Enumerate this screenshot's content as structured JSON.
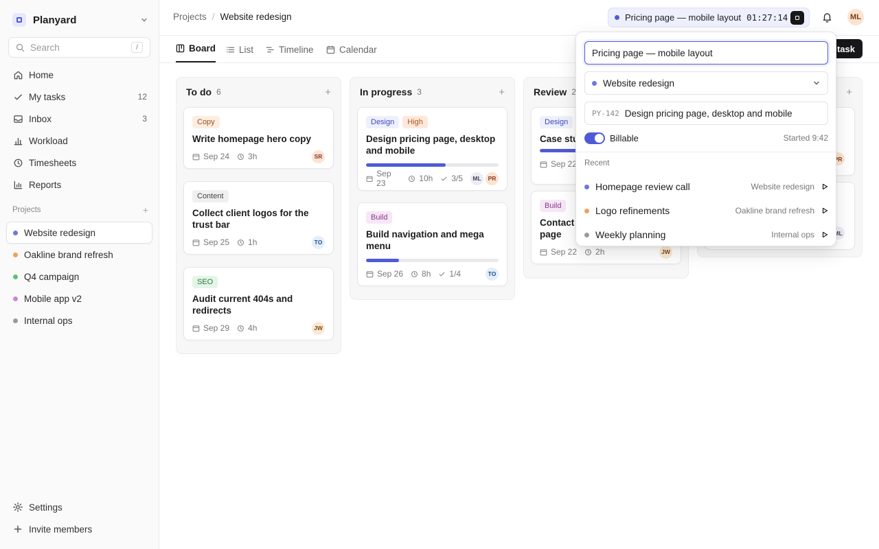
{
  "sidebar": {
    "workspace": "Planyard",
    "search_placeholder": "Search",
    "search_shortcut": "/",
    "nav": [
      {
        "label": "Home",
        "icon": "home-icon",
        "count": ""
      },
      {
        "label": "My tasks",
        "icon": "check-icon",
        "count": "12"
      },
      {
        "label": "Inbox",
        "icon": "inbox-icon",
        "count": "3"
      },
      {
        "label": "Workload",
        "icon": "workload-icon",
        "count": ""
      },
      {
        "label": "Timesheets",
        "icon": "clock-icon",
        "count": ""
      },
      {
        "label": "Reports",
        "icon": "bar-chart-icon",
        "count": ""
      }
    ],
    "projects_label": "Projects",
    "projects": [
      {
        "label": "Website redesign",
        "color": "#6d78e0"
      },
      {
        "label": "Oakline brand refresh",
        "color": "#f0a15f"
      },
      {
        "label": "Q4 campaign",
        "color": "#5cc079"
      },
      {
        "label": "Mobile app v2",
        "color": "#c987d6"
      },
      {
        "label": "Internal ops",
        "color": "#9a9a9a"
      }
    ],
    "settings_label": "Settings",
    "invite_label": "Invite members"
  },
  "header": {
    "breadcrumb_parent": "Projects",
    "breadcrumb_current": "Website redesign",
    "timer_label": "Pricing page — mobile layout",
    "timer_time": "01:27:14",
    "user_initials": "ML"
  },
  "tabs": [
    {
      "label": "Board"
    },
    {
      "label": "List"
    },
    {
      "label": "Timeline"
    },
    {
      "label": "Calendar"
    }
  ],
  "new_task_visible": "task",
  "columns": [
    {
      "title": "To do",
      "count": "6",
      "cards": [
        {
          "tags": [
            {
              "label": "Copy",
              "kind": "copy"
            }
          ],
          "title": "Write homepage hero copy",
          "date": "Sep 24",
          "hours": "3h",
          "checks": "",
          "assignees": [
            "SR"
          ]
        },
        {
          "tags": [
            {
              "label": "Content",
              "kind": "content"
            }
          ],
          "title": "Collect client logos for the trust bar",
          "date": "Sep 25",
          "hours": "1h",
          "checks": "",
          "assignees": [
            "TO"
          ]
        },
        {
          "tags": [
            {
              "label": "SEO",
              "kind": "seo"
            }
          ],
          "title": "Audit current 404s and redirects",
          "date": "Sep 29",
          "hours": "4h",
          "checks": "",
          "assignees": [
            "JW"
          ]
        }
      ]
    },
    {
      "title": "In progress",
      "count": "3",
      "cards": [
        {
          "tags": [
            {
              "label": "Design",
              "kind": "design"
            },
            {
              "label": "High",
              "kind": "high"
            }
          ],
          "title": "Design pricing page, desktop and mobile",
          "progress": 0.6,
          "date": "Sep 23",
          "hours": "10h",
          "checks": "3/5",
          "assignees": [
            "ML",
            "PR"
          ]
        },
        {
          "tags": [
            {
              "label": "Build",
              "kind": "build"
            }
          ],
          "title": "Build navigation and mega menu",
          "progress": 0.25,
          "date": "Sep 26",
          "hours": "8h",
          "checks": "1/4",
          "assignees": [
            "TO"
          ]
        }
      ]
    },
    {
      "title": "Review",
      "count": "2",
      "cards": [
        {
          "tags": [
            {
              "label": "Design",
              "kind": "design"
            }
          ],
          "title": "Case stu",
          "progress": 0.3,
          "date": "Sep 22",
          "hours": "",
          "checks": "",
          "assignees": []
        },
        {
          "tags": [
            {
              "label": "Build",
              "kind": "build"
            }
          ],
          "title": "Contact form page",
          "title_line1": "Contact ",
          "title_line2": "page",
          "date": "Sep 22",
          "hours": "2h",
          "checks": "",
          "assignees": [
            "JW"
          ]
        }
      ]
    },
    {
      "title": "",
      "count": "",
      "cards": [
        {
          "assignees": [
            "PR"
          ]
        },
        {
          "assignees": [
            "ML"
          ]
        }
      ]
    }
  ],
  "popover": {
    "description_value": "Pricing page — mobile layout",
    "project": "Website redesign",
    "project_color": "#6d78e0",
    "task_id": "PY-142",
    "task_title": "Design pricing page, desktop and mobile",
    "billable_label": "Billable",
    "billable": true,
    "started": "Started 9:42",
    "recent_label": "Recent",
    "recent": [
      {
        "name": "Homepage review call",
        "project": "Website redesign",
        "color": "#6d78e0"
      },
      {
        "name": "Logo refinements",
        "project": "Oakline brand refresh",
        "color": "#f0a15f"
      },
      {
        "name": "Weekly planning",
        "project": "Internal ops",
        "color": "#9a9a9a"
      }
    ]
  },
  "avatar_colors": {
    "SR": {
      "bg": "#fbe3d6",
      "fg": "#8a3b1a"
    },
    "TO": {
      "bg": "#e2eefb",
      "fg": "#21507f"
    },
    "JW": {
      "bg": "#fbe9d6",
      "fg": "#7a4a12"
    },
    "ML": {
      "bg": "#ececf3",
      "fg": "#44445a"
    },
    "PR": {
      "bg": "#fbe3d1",
      "fg": "#8a3b1a"
    }
  }
}
